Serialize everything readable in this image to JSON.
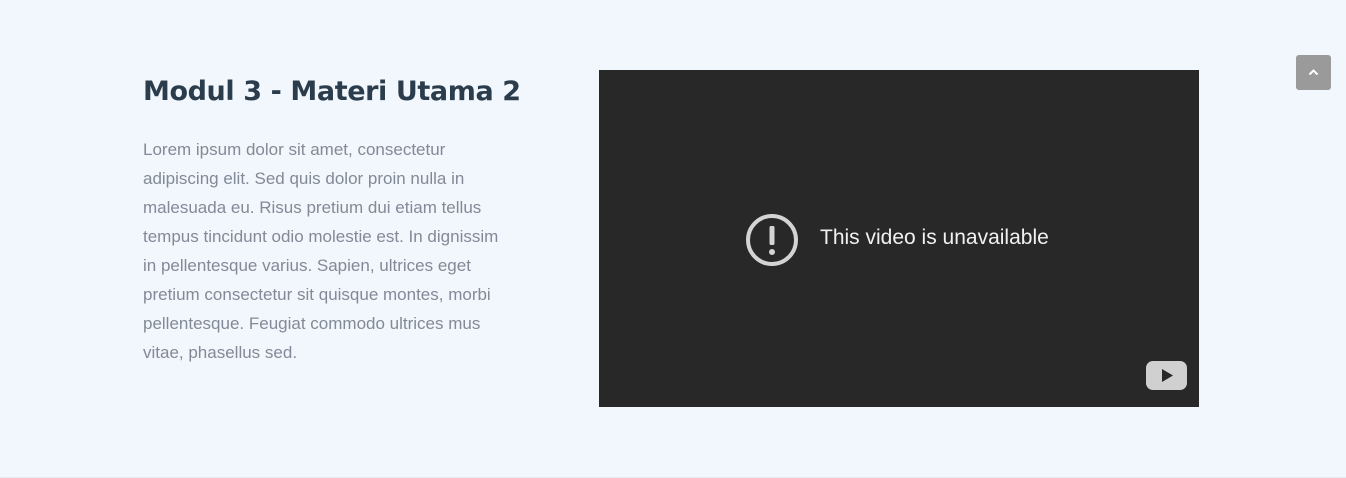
{
  "module": {
    "title": "Modul 3 - Materi Utama 2",
    "description": "Lorem ipsum dolor sit amet, consectetur adipiscing elit. Sed quis dolor proin nulla in malesuada eu. Risus pretium dui etiam tellus tempus tincidunt odio molestie est. In dignissim in pellentesque varius. Sapien, ultrices eget pretium consectetur sit quisque montes, morbi pellentesque. Feugiat commodo ultrices mus vitae, phasellus sed."
  },
  "video": {
    "message": "This video is unavailable",
    "status_icon": "alert-circle-icon",
    "logo_icon": "youtube-logo-icon"
  },
  "scroll_to_top": {
    "icon": "chevron-up-icon"
  },
  "colors": {
    "page_background": "#f2f7fd",
    "title": "#2b3d4d",
    "body_text": "#818a96",
    "video_background": "#282828",
    "scroll_button": "#9a9a9a"
  }
}
